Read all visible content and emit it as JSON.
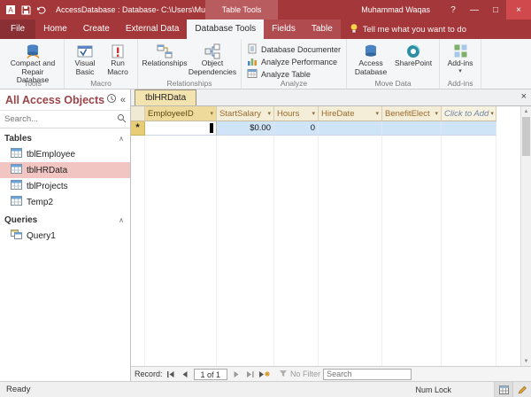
{
  "colors": {
    "accent": "#a4373a",
    "tab_fill": "#f3e3ae",
    "selection_row": "#cfe5f7",
    "nav_selected": "#f1c5c2"
  },
  "titlebar": {
    "title": "AccessDatabase : Database- C:\\Users\\Mu...",
    "contextual_group": "Table Tools",
    "user": "Muhammad Waqas",
    "help": "?",
    "minimize": "—",
    "maximize": "□",
    "close": "×"
  },
  "ribbon": {
    "tabs": [
      {
        "label": "File"
      },
      {
        "label": "Home"
      },
      {
        "label": "Create"
      },
      {
        "label": "External Data"
      },
      {
        "label": "Database Tools"
      },
      {
        "label": "Fields"
      },
      {
        "label": "Table"
      }
    ],
    "tell_me": "Tell me what you want to do",
    "groups": [
      {
        "label": "Tools",
        "buttons": [
          {
            "label": "Compact and Repair Database"
          }
        ]
      },
      {
        "label": "Macro",
        "buttons": [
          {
            "label": "Visual Basic"
          },
          {
            "label": "Run Macro"
          }
        ]
      },
      {
        "label": "Relationships",
        "buttons": [
          {
            "label": "Relationships"
          },
          {
            "label": "Object Dependencies"
          }
        ]
      },
      {
        "label": "Analyze",
        "buttons": [
          {
            "label": "Database Documenter"
          },
          {
            "label": "Analyze Performance"
          },
          {
            "label": "Analyze Table"
          }
        ]
      },
      {
        "label": "Move Data",
        "buttons": [
          {
            "label": "Access Database"
          },
          {
            "label": "SharePoint"
          }
        ]
      },
      {
        "label": "Add-ins",
        "buttons": [
          {
            "label": "Add-ins"
          }
        ]
      }
    ]
  },
  "sidebar": {
    "title": "All Access Objects",
    "search_placeholder": "Search...",
    "sections": [
      {
        "label": "Tables",
        "items": [
          {
            "name": "tblEmployee"
          },
          {
            "name": "tblHRData"
          },
          {
            "name": "tblProjects"
          },
          {
            "name": "Temp2"
          }
        ]
      },
      {
        "label": "Queries",
        "items": [
          {
            "name": "Query1"
          }
        ]
      }
    ]
  },
  "document": {
    "tab": "tblHRData",
    "close": "×",
    "columns": [
      {
        "label": "EmployeeID"
      },
      {
        "label": "StartSalary"
      },
      {
        "label": "Hours"
      },
      {
        "label": "HireDate"
      },
      {
        "label": "BenefitElect"
      },
      {
        "label": "Click to Add"
      }
    ],
    "new_row": {
      "marker": "*",
      "start_salary": "$0.00",
      "hours": "0"
    }
  },
  "record_nav": {
    "label": "Record:",
    "position": "1 of 1",
    "no_filter": "No Filter",
    "search_placeholder": "Search"
  },
  "status": {
    "left": "Ready",
    "num_lock": "Num Lock"
  },
  "icons": {
    "dropdown": "▾",
    "pane_collapse": "«",
    "section_collapse": "∧",
    "scroll_up": "▲",
    "scroll_down": "▼"
  }
}
